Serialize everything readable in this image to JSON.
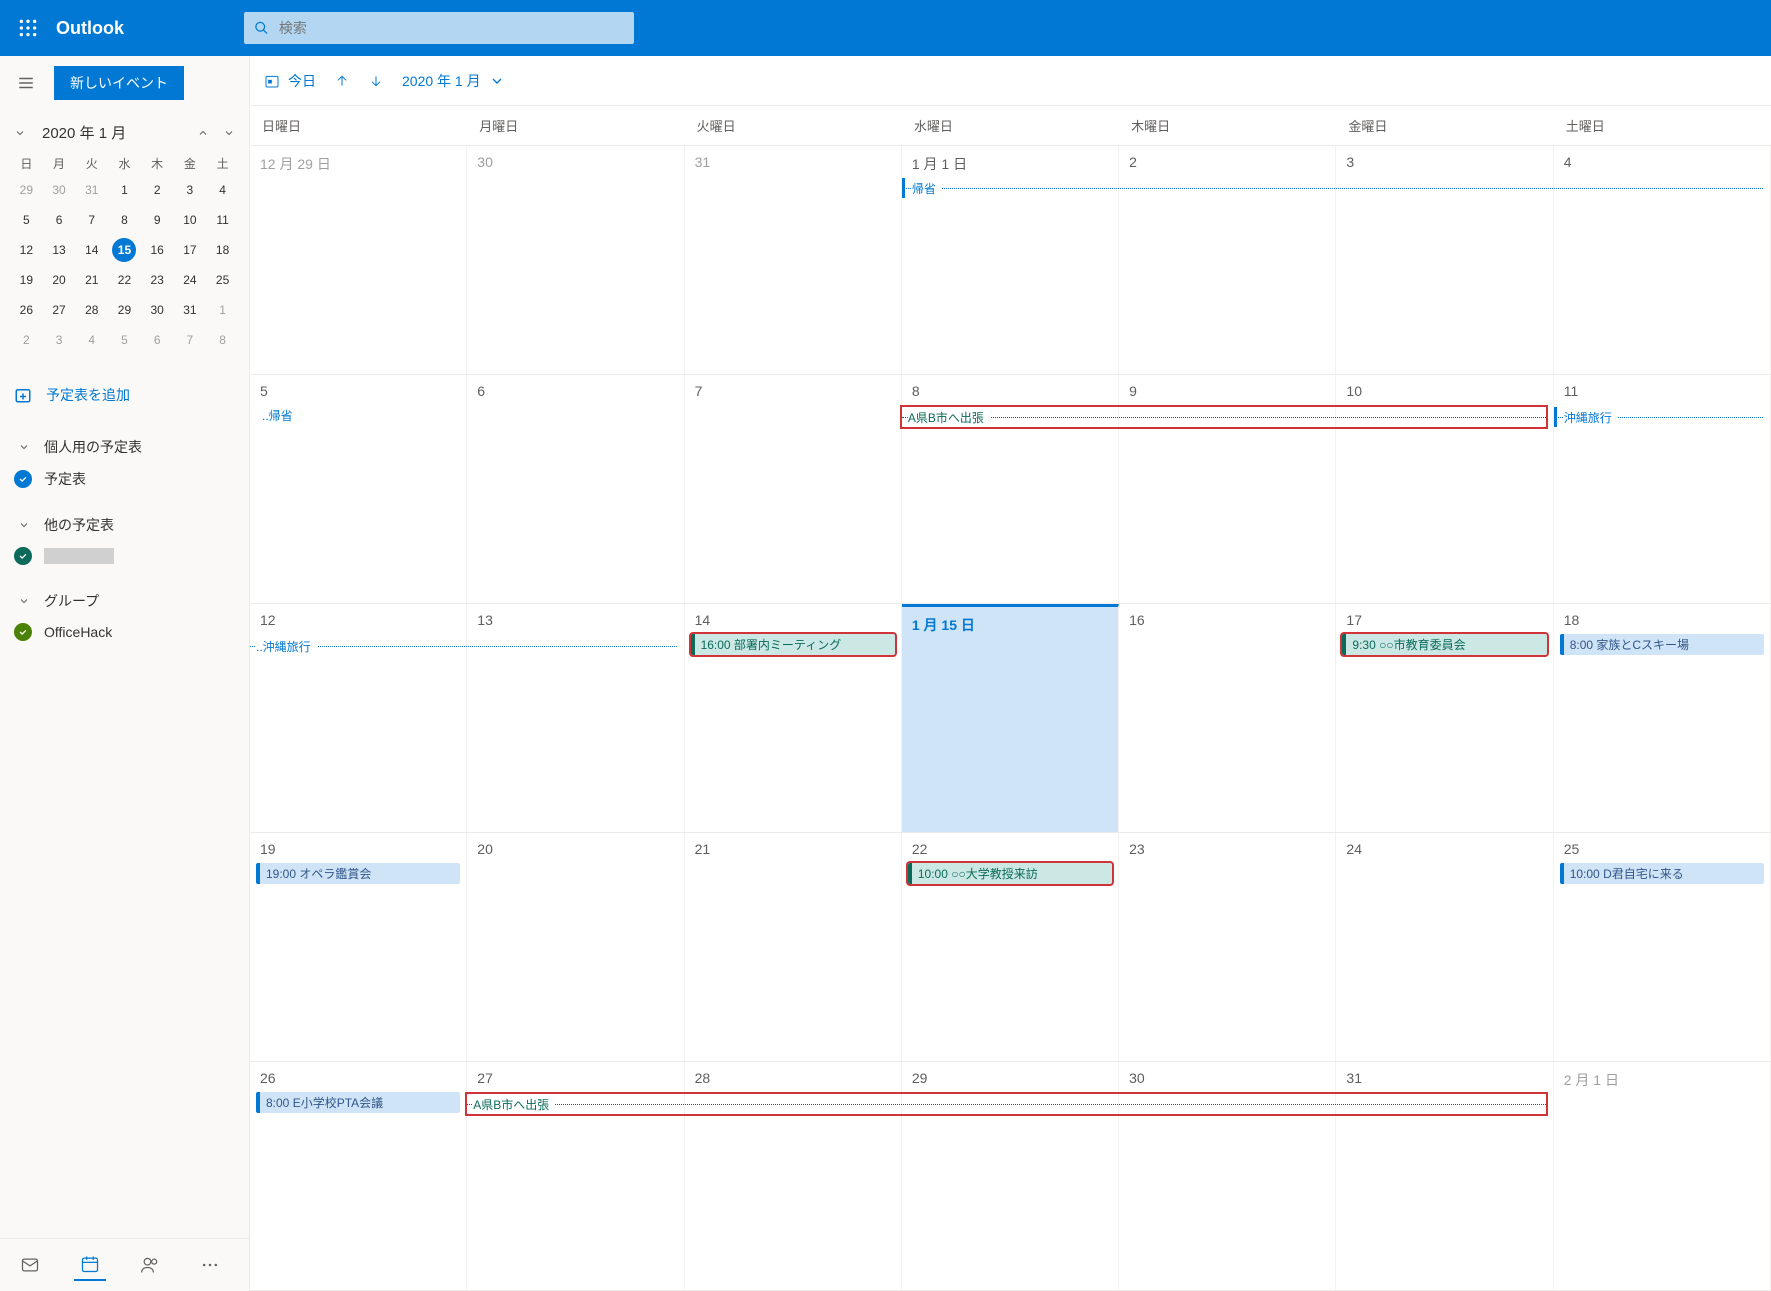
{
  "app": {
    "name": "Outlook"
  },
  "search": {
    "placeholder": "検索"
  },
  "sidebar": {
    "newEventLabel": "新しいイベント",
    "miniTitle": "2020 年 1 月",
    "dow": [
      "日",
      "月",
      "火",
      "水",
      "木",
      "金",
      "土"
    ],
    "miniRows": [
      [
        "29",
        "30",
        "31",
        "1",
        "2",
        "3",
        "4"
      ],
      [
        "5",
        "6",
        "7",
        "8",
        "9",
        "10",
        "11"
      ],
      [
        "12",
        "13",
        "14",
        "15",
        "16",
        "17",
        "18"
      ],
      [
        "19",
        "20",
        "21",
        "22",
        "23",
        "24",
        "25"
      ],
      [
        "26",
        "27",
        "28",
        "29",
        "30",
        "31",
        "1"
      ],
      [
        "2",
        "3",
        "4",
        "5",
        "6",
        "7",
        "8"
      ]
    ],
    "miniOutStart": 3,
    "miniOutEnd1": 1,
    "miniToday": "15",
    "addCal": "予定表を追加",
    "sections": {
      "personal": {
        "label": "個人用の予定表",
        "item": "予定表"
      },
      "other": {
        "label": "他の予定表",
        "item": ""
      },
      "group": {
        "label": "グループ",
        "item": "OfficeHack"
      }
    }
  },
  "toolbar": {
    "today": "今日",
    "month": "2020 年 1 月"
  },
  "cal": {
    "dow": [
      "日曜日",
      "月曜日",
      "火曜日",
      "水曜日",
      "木曜日",
      "金曜日",
      "土曜日"
    ],
    "weeks": [
      {
        "days": [
          "12 月 29 日",
          "30",
          "31",
          "1 月 1 日",
          "2",
          "3",
          "4"
        ],
        "out": [
          0,
          1,
          2
        ]
      },
      {
        "days": [
          "5",
          "6",
          "7",
          "8",
          "9",
          "10",
          "11"
        ]
      },
      {
        "days": [
          "12",
          "13",
          "14",
          "1 月 15 日",
          "16",
          "17",
          "18"
        ],
        "today": 3
      },
      {
        "days": [
          "19",
          "20",
          "21",
          "22",
          "23",
          "24",
          "25"
        ]
      },
      {
        "days": [
          "26",
          "27",
          "28",
          "29",
          "30",
          "31",
          "2 月 1 日"
        ],
        "out": [
          6
        ]
      }
    ],
    "events": {
      "w0_kisei": "帰省",
      "w1_kisei": "..帰省",
      "w1_trip": "A県B市へ出張",
      "w1_okinawa": "沖縄旅行",
      "w2_okinawa": "..沖縄旅行",
      "w2_meeting": "16:00 部署内ミーティング",
      "w2_edu": "9:30 ○○市教育委員会",
      "w2_ski": "8:00 家族とCスキー場",
      "w3_opera": "19:00 オペラ鑑賞会",
      "w3_prof": "10:00 ○○大学教授来訪",
      "w3_dkun": "10:00 D君自宅に来る",
      "w4_pta": "8:00 E小学校PTA会議",
      "w4_trip": "A県B市へ出張"
    }
  }
}
